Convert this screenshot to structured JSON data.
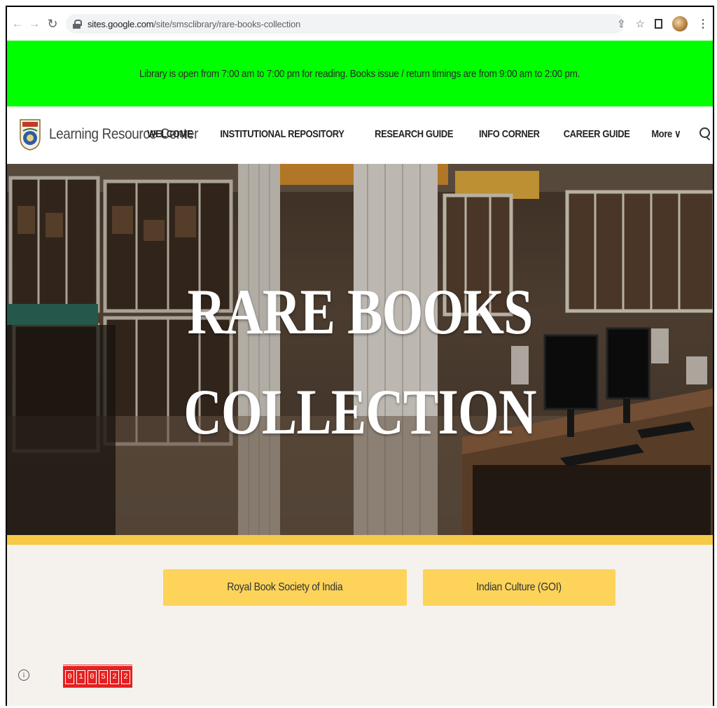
{
  "browser": {
    "url_host": "sites.google.com",
    "url_path": "/site/smsclibrary/rare-books-collection"
  },
  "announcement": "Library is open from 7:00 am to 7:00 pm for reading. Books issue / return timings are from 9:00 am to 2:00 pm.",
  "site": {
    "title": "Learning Resource Center",
    "nav": [
      "WELCOME",
      "INSTITUTIONAL REPOSITORY",
      "RESEARCH GUIDE",
      "INFO CORNER",
      "CAREER GUIDE",
      "More ∨"
    ]
  },
  "hero": {
    "line1": "RARE BOOKS",
    "line2": "COLLECTION"
  },
  "buttons": {
    "royal": "Royal Book Society of India",
    "indian_culture": "Indian Culture (GOI)"
  },
  "counter": [
    "0",
    "1",
    "0",
    "5",
    "2",
    "2"
  ],
  "colors": {
    "announcement_bg": "#00ff00",
    "accent_yellow": "#fdd35a",
    "counter_red": "#e52020"
  }
}
